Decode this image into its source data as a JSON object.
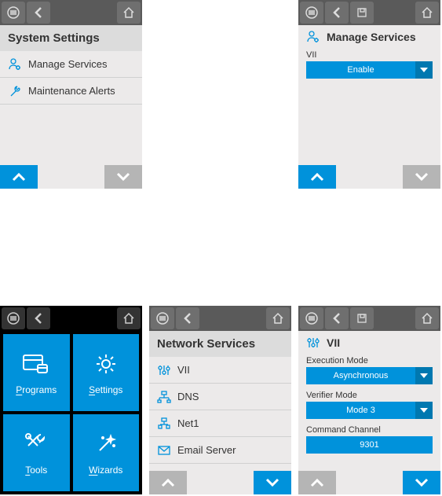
{
  "home": {
    "tiles": [
      {
        "label": "Programs",
        "u": "P",
        "rest": "rograms",
        "icon": "programs"
      },
      {
        "label": "Settings",
        "u": "S",
        "rest": "ettings",
        "icon": "settings"
      },
      {
        "label": "Tools",
        "u": "T",
        "rest": "ools",
        "icon": "tools"
      },
      {
        "label": "Wizards",
        "u": "W",
        "rest": "izards",
        "icon": "wizards"
      }
    ]
  },
  "system_settings": {
    "title": "System Settings",
    "items": [
      {
        "label": "Manage Services",
        "icon": "user-gear"
      },
      {
        "label": "Maintenance Alerts",
        "icon": "wrench"
      }
    ]
  },
  "manage_services": {
    "title": "Manage Services",
    "field_label": "VII",
    "dropdown_value": "Enable"
  },
  "network_services": {
    "title": "Network Services",
    "items": [
      {
        "label": "VII",
        "icon": "sliders"
      },
      {
        "label": "DNS",
        "icon": "net-node"
      },
      {
        "label": "Net1",
        "icon": "net-node-alt"
      },
      {
        "label": "Email Server",
        "icon": "mail"
      }
    ]
  },
  "vii_config": {
    "title": "VII",
    "fields": [
      {
        "label": "Execution Mode",
        "type": "dropdown",
        "value": "Asynchronous"
      },
      {
        "label": "Verifier Mode",
        "type": "dropdown",
        "value": "Mode 3"
      },
      {
        "label": "Command Channel",
        "type": "value",
        "value": "9301"
      }
    ]
  },
  "colors": {
    "accent": "#0092db"
  }
}
